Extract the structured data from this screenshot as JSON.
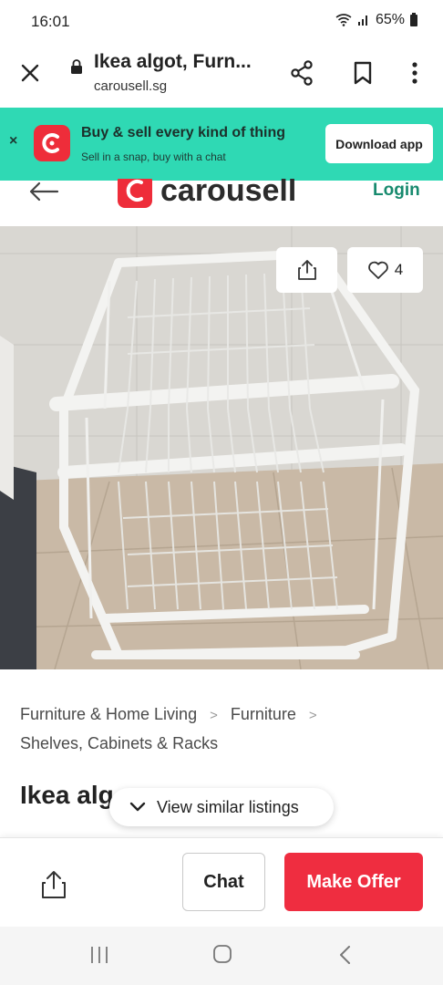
{
  "status": {
    "time": "16:01",
    "battery": "65%"
  },
  "browser": {
    "title": "Ikea algot, Furn...",
    "url": "carousell.sg"
  },
  "banner": {
    "close": "×",
    "title": "Buy & sell every kind of thing",
    "subtitle": "Sell in a snap, buy with a chat",
    "button": "Download app"
  },
  "header": {
    "logo_text": "carousell",
    "login": "Login"
  },
  "image": {
    "likes": "4"
  },
  "breadcrumb": {
    "items": [
      "Furniture & Home Living",
      "Furniture",
      "Shelves, Cabinets & Racks"
    ],
    "separator": ">"
  },
  "listing": {
    "title": "Ikea alg",
    "similar": "View similar listings"
  },
  "actions": {
    "chat": "Chat",
    "offer": "Make Offer"
  },
  "colors": {
    "banner": "#2fd9b4",
    "brand_red": "#ee2d3a",
    "offer": "#ef2d40",
    "login": "#178a6e"
  }
}
